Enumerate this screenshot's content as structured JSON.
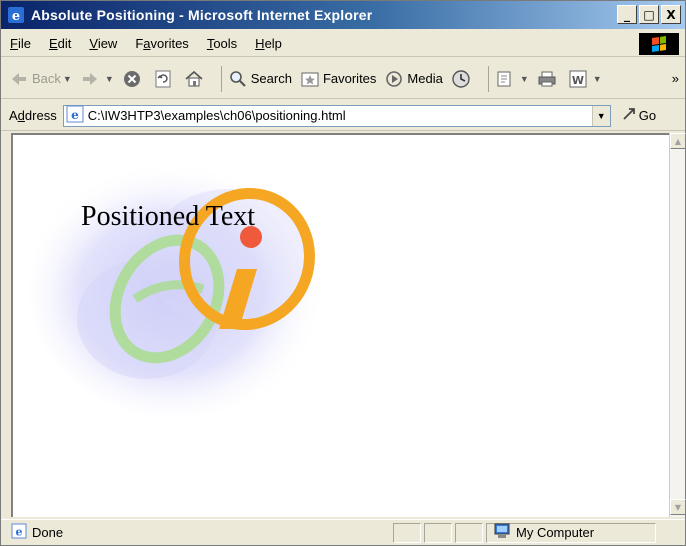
{
  "window": {
    "title": "Absolute Positioning - Microsoft Internet Explorer",
    "caption_buttons": {
      "minimize": "_",
      "maximize": "□",
      "close": "X"
    }
  },
  "menu": {
    "items": [
      {
        "pre": "",
        "key": "F",
        "post": "ile"
      },
      {
        "pre": "",
        "key": "E",
        "post": "dit"
      },
      {
        "pre": "",
        "key": "V",
        "post": "iew"
      },
      {
        "pre": "F",
        "key": "a",
        "post": "vorites"
      },
      {
        "pre": "",
        "key": "T",
        "post": "ools"
      },
      {
        "pre": "",
        "key": "H",
        "post": "elp"
      }
    ]
  },
  "toolbar": {
    "back_label": "Back",
    "search_label": "Search",
    "favorites_label": "Favorites",
    "media_label": "Media",
    "overflow": "»"
  },
  "address": {
    "label_pre": "A",
    "label_key": "d",
    "label_post": "dress",
    "value": "C:\\IW3HTP3\\examples\\ch06\\positioning.html",
    "go_label": "Go"
  },
  "page": {
    "positioned_text": "Positioned Text"
  },
  "status": {
    "text": "Done",
    "zone": "My Computer"
  },
  "colors": {
    "title_gradient_start": "#0a246a",
    "logo_orange": "#f5a623",
    "logo_green": "#a8dc8c",
    "logo_blue_cloud": "#c8c8f5"
  }
}
